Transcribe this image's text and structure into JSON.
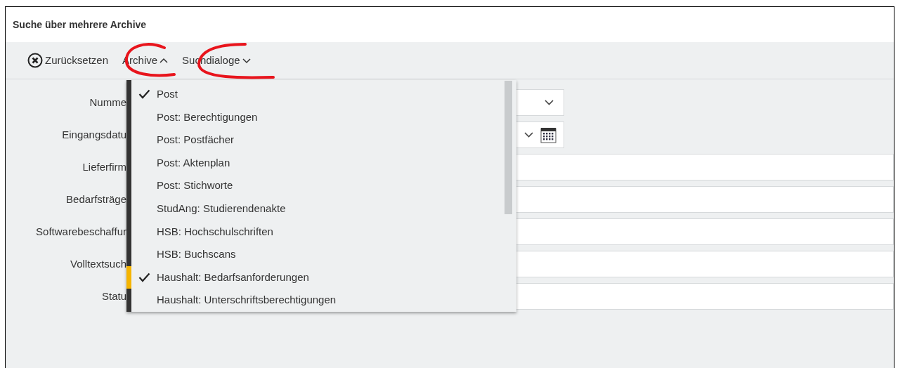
{
  "window": {
    "title": "Suche über mehrere Archive"
  },
  "toolbar": [
    {
      "kind": "reset",
      "label": "Zurücksetzen"
    },
    {
      "kind": "menu",
      "label": "Archive",
      "expanded": true
    },
    {
      "kind": "menu",
      "label": "Suchdialoge",
      "expanded": false
    }
  ],
  "form": {
    "fields": [
      {
        "label": "Numme",
        "kind": "select"
      },
      {
        "label": "Eingangsdatu",
        "kind": "date"
      },
      {
        "label": "Lieferfirm",
        "kind": "text"
      },
      {
        "label": "Bedarfsträge",
        "kind": "text"
      },
      {
        "label": "Softwarebeschaffur",
        "kind": "text"
      },
      {
        "label": "Volltextsuch",
        "kind": "text"
      },
      {
        "label": "Statu",
        "kind": "text"
      }
    ]
  },
  "archive_menu": {
    "items": [
      {
        "label": "Post",
        "checked": true,
        "hovered": false
      },
      {
        "label": "Post: Berechtigungen",
        "checked": false,
        "hovered": false
      },
      {
        "label": "Post: Postfächer",
        "checked": false,
        "hovered": false
      },
      {
        "label": "Post: Aktenplan",
        "checked": false,
        "hovered": false
      },
      {
        "label": "Post: Stichworte",
        "checked": false,
        "hovered": false
      },
      {
        "label": "StudAng: Studierendenakte",
        "checked": false,
        "hovered": false
      },
      {
        "label": "HSB: Hochschulschriften",
        "checked": false,
        "hovered": false
      },
      {
        "label": "HSB: Buchscans",
        "checked": false,
        "hovered": false
      },
      {
        "label": "Haushalt: Bedarfsanforderungen",
        "checked": true,
        "hovered": true
      },
      {
        "label": "Haushalt: Unterschriftsberechtigungen",
        "checked": false,
        "hovered": false
      }
    ]
  }
}
